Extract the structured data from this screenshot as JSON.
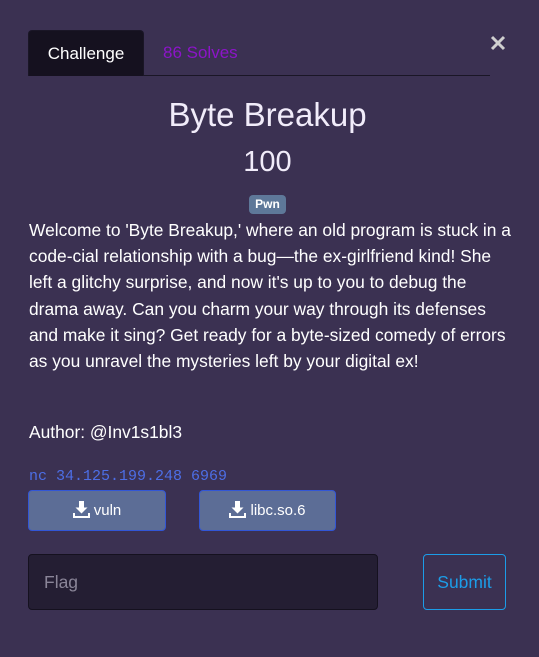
{
  "tabs": {
    "challenge_label": "Challenge",
    "solves_label": "86 Solves"
  },
  "close_icon": "close-icon",
  "challenge": {
    "name": "Byte Breakup",
    "points": "100",
    "category": "Pwn",
    "description": "Welcome to 'Byte Breakup,' where an old program is stuck in a code-cial relationship with a bug—the ex-girlfriend kind! She left a glitchy surprise, and now it's up to you to debug the drama away. Can you charm your way through its defenses and make it sing? Get ready for a byte-sized comedy of errors as you unravel the mysteries left by your digital ex!",
    "author": "Author: @Inv1s1bl3",
    "connection": "nc 34.125.199.248 6969"
  },
  "files": [
    {
      "name": "vuln",
      "icon": "download-icon"
    },
    {
      "name": "libc.so.6",
      "icon": "download-icon"
    }
  ],
  "form": {
    "flag_value": "",
    "flag_placeholder": "Flag",
    "submit_label": "Submit"
  },
  "colors": {
    "background": "#3b3152",
    "active_tab": "#15111f",
    "solves_link": "#8c14c9",
    "badge": "#5e7899",
    "connection_text": "#4d6ee6",
    "download_button": "#5c6d96",
    "submit_accent": "#1c9de8"
  }
}
